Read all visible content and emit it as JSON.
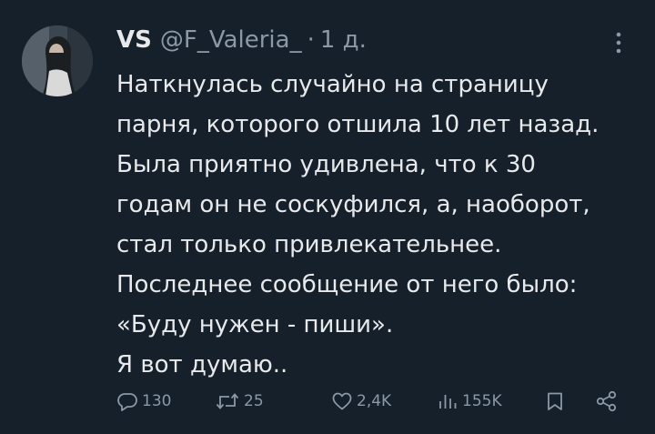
{
  "tweet": {
    "display_name": "VS",
    "handle": "@F_Valeria_",
    "separator": "·",
    "time": "1 д.",
    "text_lines": [
      "Наткнулась случайно на страницу",
      "парня, которого отшила 10 лет назад.",
      "Была приятно удивлена, что к 30",
      "годам он не соскуфился, а, наоборот,",
      "стал только привлекательнее.",
      "Последнее сообщение от него было:",
      "«Буду нужен - пиши».",
      "Я вот думаю.."
    ]
  },
  "actions": {
    "replies": "130",
    "retweets": "25",
    "likes": "2,4K",
    "views": "155K"
  },
  "icons": {
    "more": "more-vertical-icon",
    "reply": "reply-icon",
    "retweet": "retweet-icon",
    "like": "heart-icon",
    "views": "views-bar-icon",
    "bookmark": "bookmark-icon",
    "share": "share-icon"
  },
  "colors": {
    "background": "#15202b",
    "text": "#e7e9ea",
    "secondary": "#8b98a5"
  }
}
